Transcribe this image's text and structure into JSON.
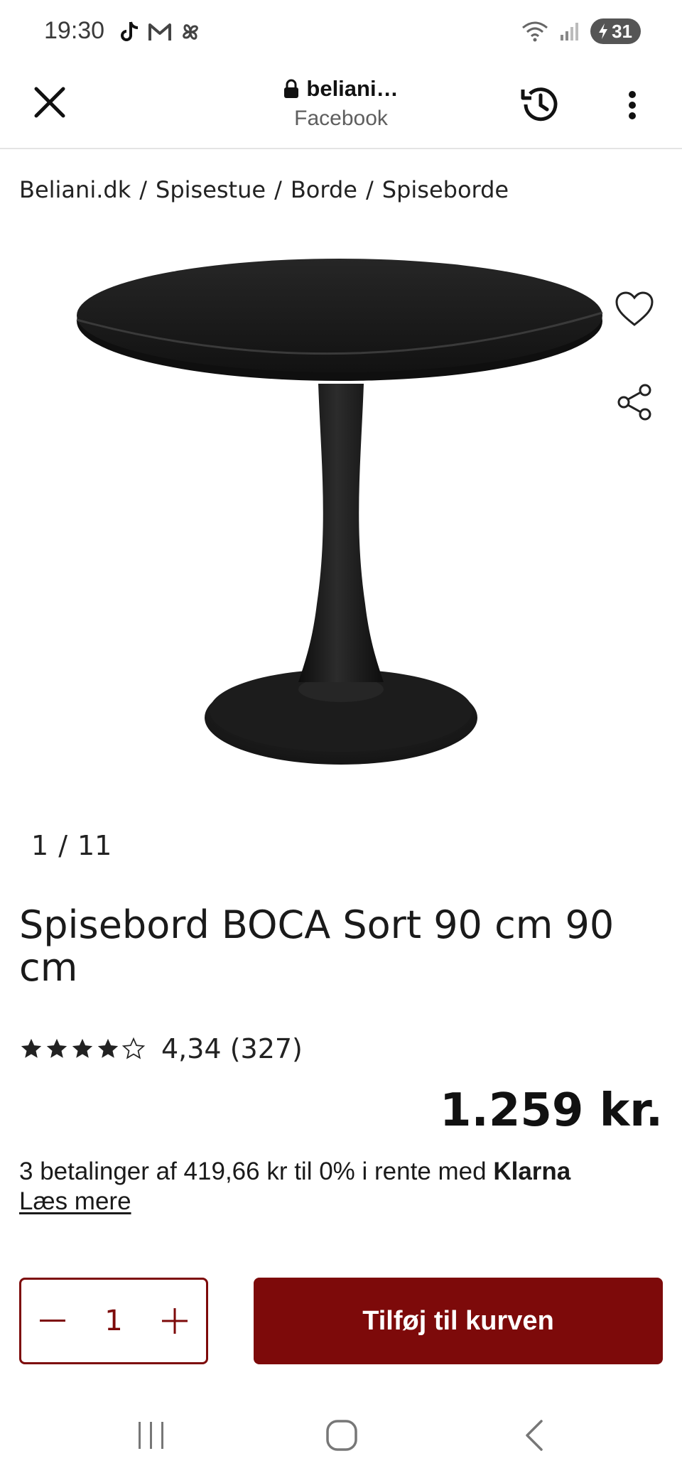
{
  "status_bar": {
    "time": "19:30",
    "battery": "31",
    "icons": [
      "tiktok-icon",
      "gmail-icon",
      "pinwheel-icon",
      "wifi-icon",
      "signal-icon",
      "battery-charging-icon"
    ]
  },
  "browser": {
    "url": "beliani…",
    "source": "Facebook",
    "icons": [
      "close-icon",
      "lock-icon",
      "history-icon",
      "more-vert-icon"
    ]
  },
  "breadcrumb": {
    "items": [
      "Beliani.dk",
      "Spisestue",
      "Borde",
      "Spiseborde"
    ],
    "separator": "/"
  },
  "gallery": {
    "current": "1",
    "separator": "/",
    "total": "11"
  },
  "product": {
    "title": "Spisebord BOCA Sort 90 cm 90 cm",
    "rating_text": "4,34 (327)",
    "rating_value": 4.34,
    "price": "1.259 kr.",
    "klarna_text": "3 betalinger af 419,66 kr til 0% i rente med ",
    "klarna_brand": "Klarna",
    "read_more": "Læs mere"
  },
  "cart": {
    "quantity": "1",
    "add_label": "Tilføj til kurven"
  },
  "colors": {
    "brand": "#7d0a0a",
    "text": "#1a1a1a"
  }
}
